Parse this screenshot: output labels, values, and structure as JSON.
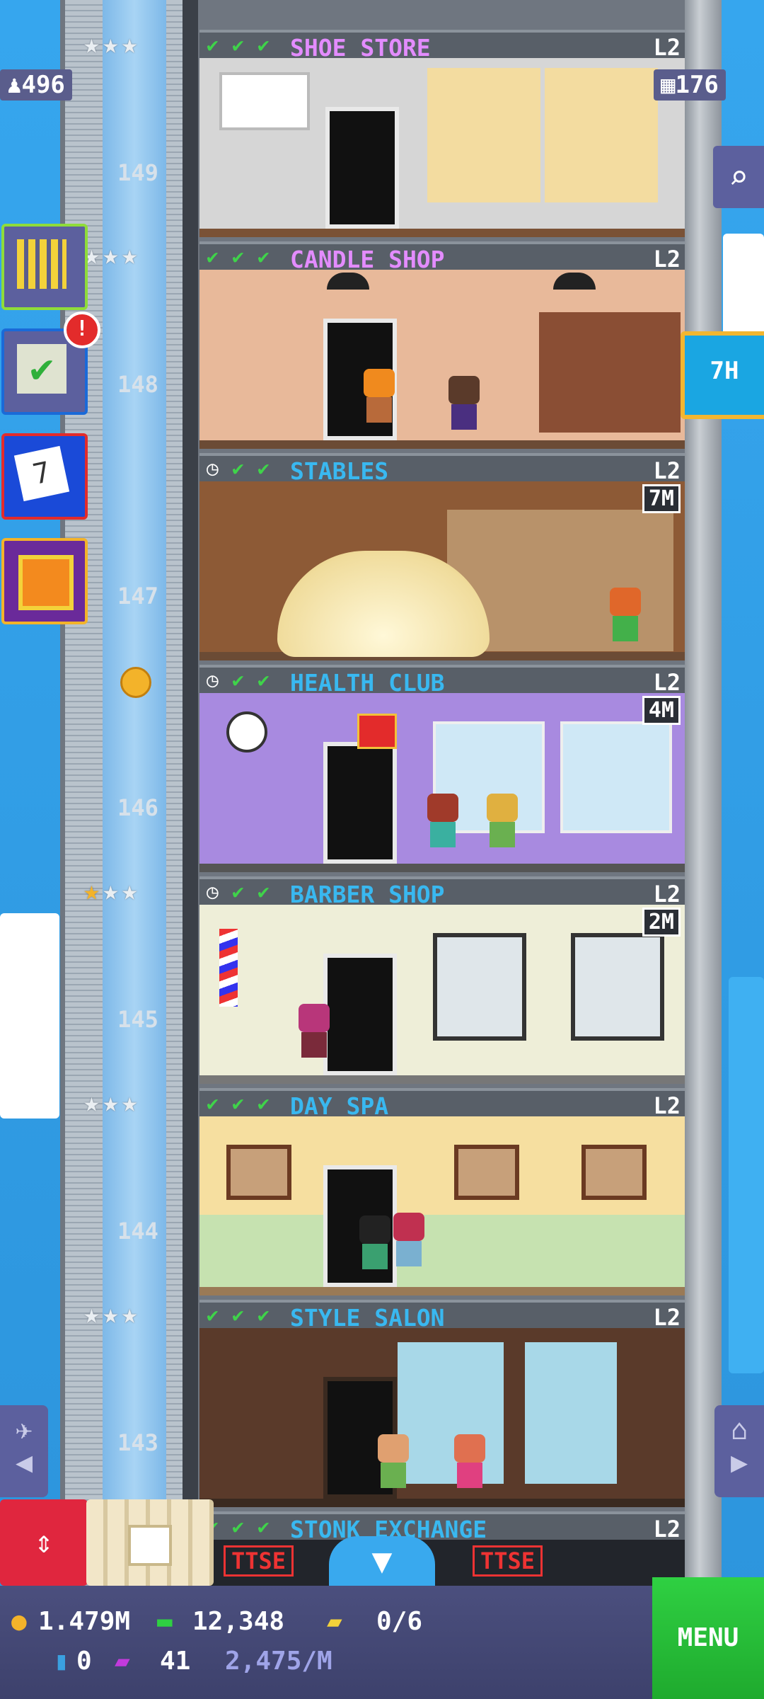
{
  "stats": {
    "population": "496",
    "floors": "176"
  },
  "timer_button": {
    "label": "7H"
  },
  "notifications": {
    "missions_badge": "!"
  },
  "floors": [
    {
      "number": "",
      "name": "SHOE STORE",
      "level": "L2",
      "color": "#e38cff",
      "checks": 3,
      "clock": false,
      "restock_tag": ""
    },
    {
      "number": "149",
      "name": "CANDLE SHOP",
      "level": "L2",
      "color": "#e38cff",
      "checks": 3,
      "clock": false,
      "restock_tag": ""
    },
    {
      "number": "148",
      "name": "STABLES",
      "level": "L2",
      "color": "#39b8f0",
      "checks": 2,
      "clock": true,
      "restock_tag": "7M"
    },
    {
      "number": "147",
      "name": "HEALTH CLUB",
      "level": "L2",
      "color": "#39b8f0",
      "checks": 2,
      "clock": true,
      "restock_tag": "4M"
    },
    {
      "number": "146",
      "name": "BARBER SHOP",
      "level": "L2",
      "color": "#39b8f0",
      "checks": 2,
      "clock": true,
      "restock_tag": "2M"
    },
    {
      "number": "145",
      "name": "DAY SPA",
      "level": "L2",
      "color": "#39b8f0",
      "checks": 3,
      "clock": false,
      "restock_tag": ""
    },
    {
      "number": "144",
      "name": "STYLE SALON",
      "level": "L2",
      "color": "#39b8f0",
      "checks": 3,
      "clock": false,
      "restock_tag": ""
    },
    {
      "number": "143",
      "name": "STONK EXCHANGE",
      "level": "L2",
      "color": "#39b8f0",
      "checks": 3,
      "clock": false,
      "restock_tag": ""
    }
  ],
  "stonk_signs": [
    "TTSE",
    "TTSE"
  ],
  "bottom_bar": {
    "coins": "1.479M",
    "bux": "12,348",
    "tickets": "0/6",
    "keys": "0",
    "golden_tickets": "41",
    "income": "2,475/M",
    "menu_label": "MENU"
  }
}
